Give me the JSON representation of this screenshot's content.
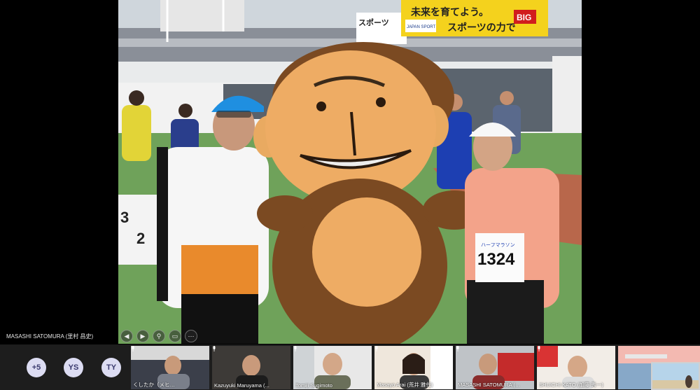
{
  "presenter": {
    "name": "MASASHI SATOMURA (里村 昌史)"
  },
  "photo": {
    "banner_main": "未来を育てよう。",
    "banner_sub": "スポーツの力で",
    "banner_brand": "BIG",
    "banner_small": "JAPAN SPORT",
    "banner_left": "スポーツ",
    "bib_number": "1324",
    "bib_caption": "ハーフマラソン",
    "barrier_digits": [
      "3",
      "2"
    ]
  },
  "controls": [
    "◀",
    "▶",
    "⚲",
    "▭",
    "⋯"
  ],
  "participants": {
    "overflow": "+5",
    "avatars": [
      "YS",
      "TY"
    ],
    "tiles": [
      {
        "name": "くしたか（メヒ…"
      },
      {
        "name": "Kazuyuki Maruyama (..."
      },
      {
        "name": "Tomiji Sugimoto"
      },
      {
        "name": "Masayo Arai (荒井 雅代)"
      },
      {
        "name": "MASASHI SATOMURA (里..."
      },
      {
        "name": "SHUICHI KATO (加藤 秀一)"
      },
      {
        "name": ""
      }
    ]
  },
  "colors": {
    "accent": "#3b3b6e",
    "strip_bg": "#1d1d1d",
    "bubble_bg": "#dcdcf2"
  }
}
